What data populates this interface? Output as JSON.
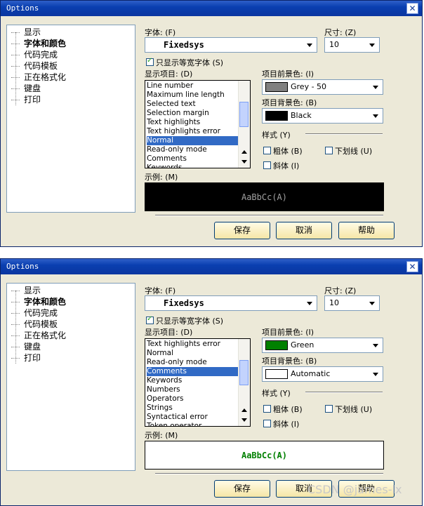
{
  "dialogs": [
    {
      "title": "Options",
      "close": "✕",
      "tree": [
        "显示",
        "字体和颜色",
        "代码完成",
        "代码模板",
        "正在格式化",
        "键盘",
        "打印"
      ],
      "tree_selected": 1,
      "font_label": "字体: (F)",
      "font_value": "Fixedsys",
      "size_label": "尺寸: (Z)",
      "size_value": "10",
      "mono_only_label": "只显示等宽字体 (S)",
      "mono_only_checked": true,
      "items_label": "显示项目: (D)",
      "items": [
        "Line number",
        "Maximum line length",
        "Selected text",
        "Selection margin",
        "Text highlights",
        "Text highlights error",
        "Normal",
        "Read-only mode",
        "Comments",
        "Keywords"
      ],
      "items_selected": 6,
      "fg_label": "项目前景色: (I)",
      "fg_value": "Grey - 50",
      "fg_color": "#808080",
      "bg_label": "项目背景色: (B)",
      "bg_value": "Black",
      "bg_color": "#000000",
      "style_label": "样式 (Y)",
      "bold_label": "粗体 (B)",
      "underline_label": "下划线 (U)",
      "italic_label": "斜体 (I)",
      "sample_label": "示例: (M)",
      "sample_text": "AaBbCc(A)",
      "sample_fg": "#a0a0a0",
      "sample_bg": "#000000",
      "save": "保存",
      "cancel": "取消",
      "help": "帮助"
    },
    {
      "title": "Options",
      "close": "✕",
      "tree": [
        "显示",
        "字体和颜色",
        "代码完成",
        "代码模板",
        "正在格式化",
        "键盘",
        "打印"
      ],
      "tree_selected": 1,
      "font_label": "字体: (F)",
      "font_value": "Fixedsys",
      "size_label": "尺寸: (Z)",
      "size_value": "10",
      "mono_only_label": "只显示等宽字体 (S)",
      "mono_only_checked": true,
      "items_label": "显示项目: (D)",
      "items": [
        "Text highlights error",
        "Normal",
        "Read-only mode",
        "Comments",
        "Keywords",
        "Numbers",
        "Operators",
        "Strings",
        "Syntactical error",
        "Token operator"
      ],
      "items_selected": 3,
      "fg_label": "项目前景色: (I)",
      "fg_value": "Green",
      "fg_color": "#008000",
      "bg_label": "项目背景色: (B)",
      "bg_value": "Automatic",
      "bg_color": "#ffffff",
      "style_label": "样式 (Y)",
      "bold_label": "粗体 (B)",
      "underline_label": "下划线 (U)",
      "italic_label": "斜体 (I)",
      "sample_label": "示例: (M)",
      "sample_text": "AaBbCc(A)",
      "sample_fg": "#008000",
      "sample_bg": "#ffffff",
      "save": "保存",
      "cancel": "取消",
      "help": "帮助"
    }
  ],
  "watermark": "CSDN @james-lx"
}
